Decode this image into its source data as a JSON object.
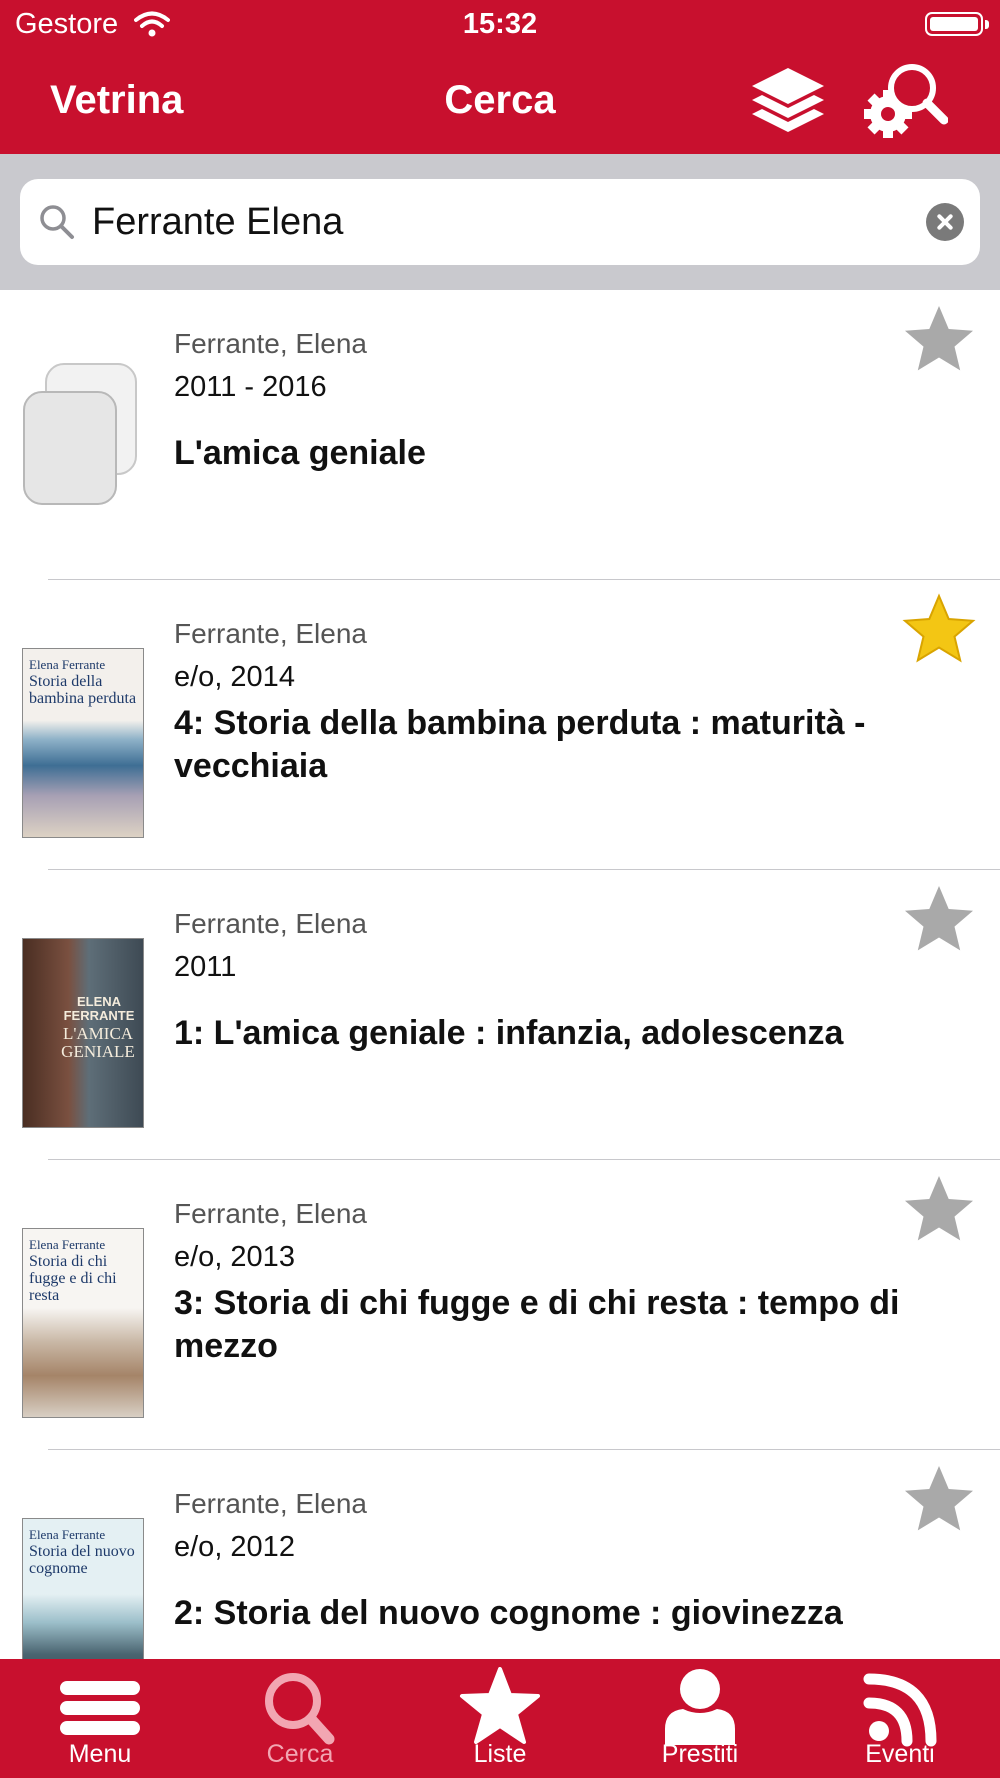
{
  "status": {
    "carrier": "Gestore",
    "time": "15:32"
  },
  "navbar": {
    "left_label": "Vetrina",
    "title": "Cerca",
    "layers_icon": "layers-icon",
    "settings_search_icon": "gear-search-icon"
  },
  "search": {
    "value": "Ferrante Elena",
    "search_icon": "search-icon",
    "clear_icon": "clear-icon"
  },
  "results": [
    {
      "author": "Ferrante, Elena",
      "publication": "2011 - 2016",
      "title": "L'amica geniale",
      "favorite": false
    },
    {
      "author": "Ferrante, Elena",
      "publication": "e/o, 2014",
      "title": "4: Storia della bambina perduta : maturità - vecchiaia",
      "favorite": true
    },
    {
      "author": "Ferrante, Elena",
      "publication": "2011",
      "title": "1: L'amica geniale : infanzia, adolescenza",
      "favorite": false
    },
    {
      "author": "Ferrante, Elena",
      "publication": "e/o, 2013",
      "title": "3: Storia di chi fugge e di chi resta : tempo di mezzo",
      "favorite": false
    },
    {
      "author": "Ferrante, Elena",
      "publication": "e/o, 2012",
      "title": "2: Storia del nuovo cognome : giovinezza",
      "favorite": false
    }
  ],
  "covers": [
    {
      "author": "",
      "title": ""
    },
    {
      "author": "Elena Ferrante",
      "title": "Storia della bambina perduta"
    },
    {
      "author": "ELENA FERRANTE",
      "title": "L'AMICA GENIALE"
    },
    {
      "author": "Elena Ferrante",
      "title": "Storia di chi fugge e di chi resta"
    },
    {
      "author": "Elena Ferrante",
      "title": "Storia del nuovo cognome"
    }
  ],
  "tabs": [
    {
      "label": "Menu",
      "icon": "menu-icon"
    },
    {
      "label": "Cerca",
      "icon": "search-icon",
      "active": true
    },
    {
      "label": "Liste",
      "icon": "star-icon"
    },
    {
      "label": "Prestiti",
      "icon": "person-icon"
    },
    {
      "label": "Eventi",
      "icon": "rss-icon"
    }
  ],
  "colors": {
    "brand": "#c8102e",
    "tab_active": "#f2a6b2",
    "favorite": "#f3c614",
    "star_off": "#a9a9a9"
  }
}
